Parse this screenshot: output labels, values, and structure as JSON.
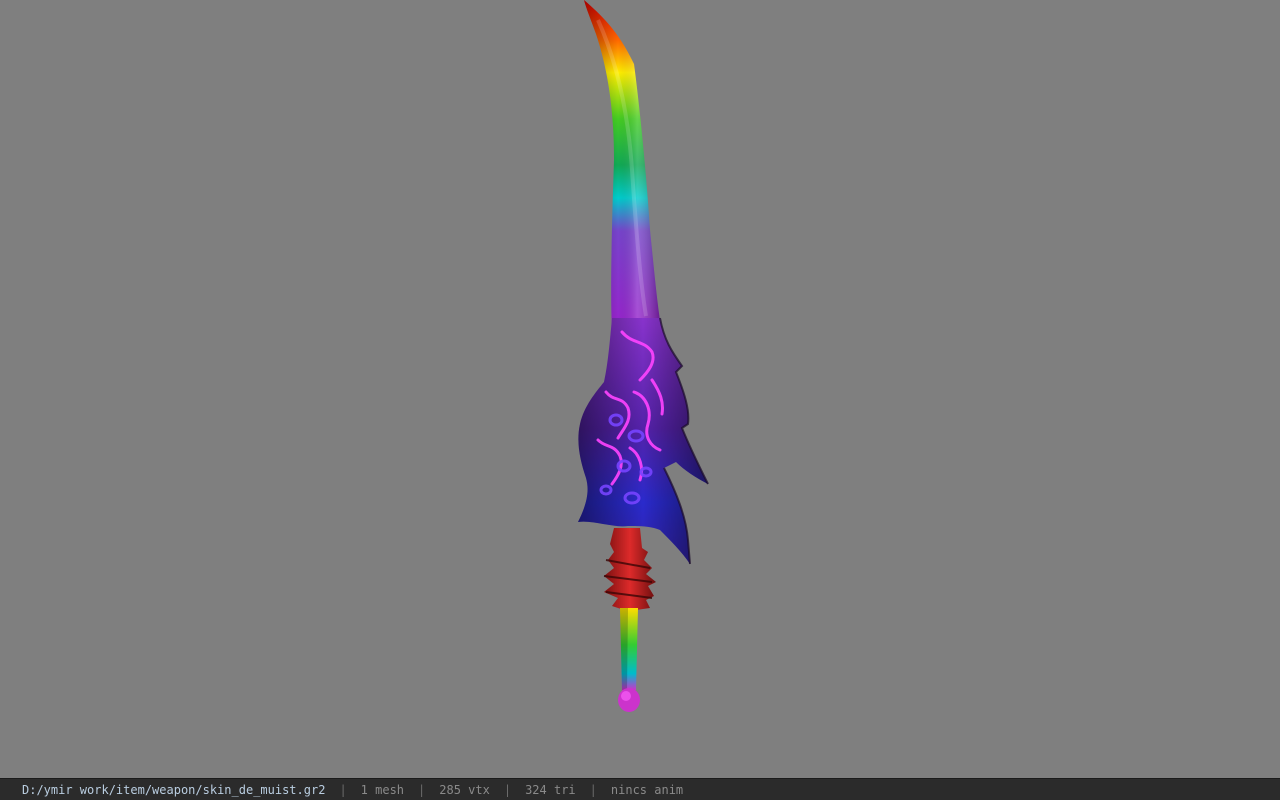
{
  "viewer": {
    "background_color": "#7f7f7f",
    "model": {
      "icon": "sword-model",
      "colors": {
        "blade_gradient": [
          "#ff0000",
          "#ff9900",
          "#ffff00",
          "#33cc33",
          "#00aa88",
          "#00cccc",
          "#6633cc",
          "#9900cc"
        ],
        "guard_base": "#4a1a88",
        "guard_pattern": "#ff33ff",
        "guard_lower": "#2222aa",
        "hilt": "#bb2222",
        "grip_gradient": [
          "#ffee00",
          "#33cc33",
          "#00cccc",
          "#cc33cc"
        ]
      }
    }
  },
  "status": {
    "path": "D:/ymir work/item/weapon/skin_de_muist.gr2",
    "meshes": "1 mesh",
    "vertices": "285 vtx",
    "triangles": "324 tri",
    "animation": "nincs anim",
    "separator": "|"
  }
}
